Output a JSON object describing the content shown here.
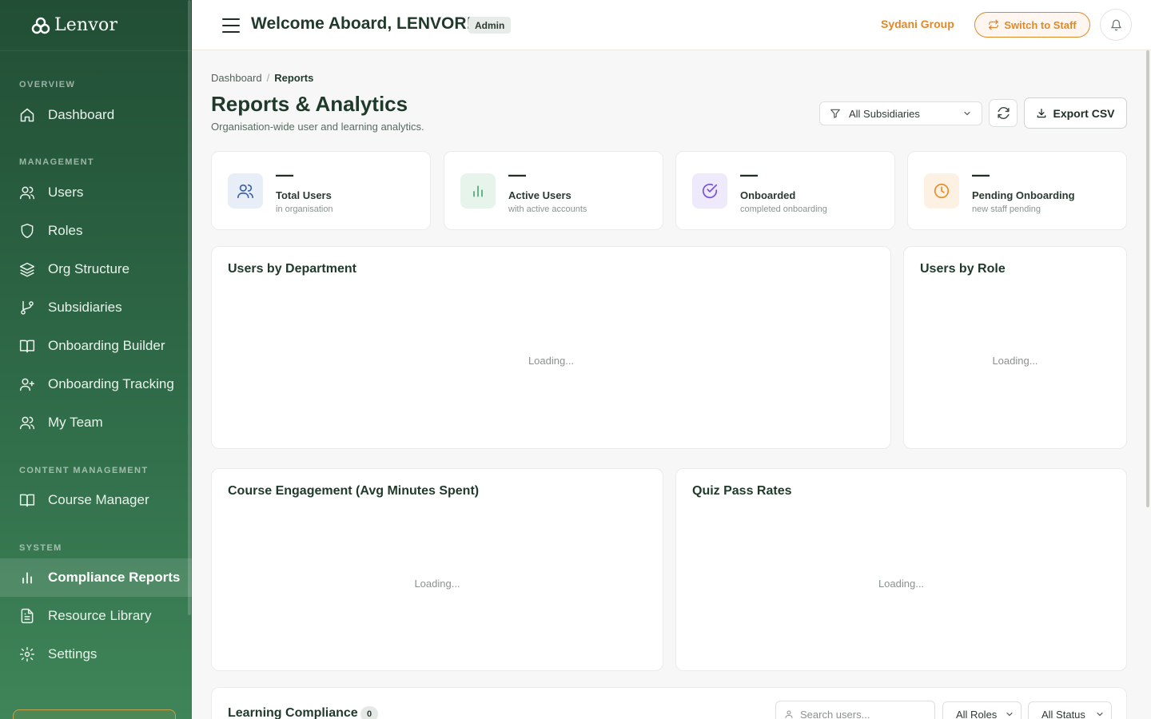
{
  "brand": {
    "name": "Lenvor"
  },
  "sidebar": {
    "sections": [
      {
        "title": "Overview",
        "items": [
          {
            "label": "Dashboard",
            "icon": "home-icon"
          }
        ]
      },
      {
        "title": "Management",
        "items": [
          {
            "label": "Users",
            "icon": "users-icon"
          },
          {
            "label": "Roles",
            "icon": "shield-icon"
          },
          {
            "label": "Org Structure",
            "icon": "layers-icon"
          },
          {
            "label": "Subsidiaries",
            "icon": "git-branch-icon"
          },
          {
            "label": "Onboarding Builder",
            "icon": "book-icon"
          },
          {
            "label": "Onboarding Tracking",
            "icon": "user-plus-icon"
          },
          {
            "label": "My Team",
            "icon": "users-icon"
          }
        ]
      },
      {
        "title": "Content Management",
        "items": [
          {
            "label": "Course Manager",
            "icon": "book-icon"
          }
        ]
      },
      {
        "title": "System",
        "items": [
          {
            "label": "Compliance Reports",
            "icon": "bar-chart-icon",
            "active": true
          },
          {
            "label": "Resource Library",
            "icon": "file-text-icon"
          },
          {
            "label": "Settings",
            "icon": "gear-icon"
          }
        ]
      }
    ]
  },
  "header": {
    "welcome": "Welcome Aboard, LENVOR!",
    "role_badge": "Admin",
    "org_name": "Sydani Group",
    "switch_label": "Switch to Staff"
  },
  "breadcrumb": {
    "root": "Dashboard",
    "separator": "/",
    "current": "Reports"
  },
  "page": {
    "title": "Reports & Analytics",
    "subtitle": "Organisation-wide user and learning analytics."
  },
  "toolbar": {
    "subsidiary_filter": "All Subsidiaries",
    "export_label": "Export CSV"
  },
  "stats": [
    {
      "value": "—",
      "label": "Total Users",
      "sub": "in organisation",
      "icon": "users-icon",
      "tint": "#e8eef8",
      "stroke": "#3a5fa8"
    },
    {
      "value": "—",
      "label": "Active Users",
      "sub": "with active accounts",
      "icon": "bar-chart-icon",
      "tint": "#e6f4ec",
      "stroke": "#3aa06a"
    },
    {
      "value": "—",
      "label": "Onboarded",
      "sub": "completed onboarding",
      "icon": "check-circle-icon",
      "tint": "#efeafb",
      "stroke": "#7b55d6"
    },
    {
      "value": "—",
      "label": "Pending Onboarding",
      "sub": "new staff pending",
      "icon": "clock-icon",
      "tint": "#fdf1e3",
      "stroke": "#e9902e"
    }
  ],
  "panels": {
    "users_by_department": {
      "title": "Users by Department",
      "loading": "Loading..."
    },
    "users_by_role": {
      "title": "Users by Role",
      "loading": "Loading..."
    },
    "course_engagement": {
      "title": "Course Engagement (Avg Minutes Spent)",
      "loading": "Loading..."
    },
    "quiz_pass_rates": {
      "title": "Quiz Pass Rates",
      "loading": "Loading..."
    }
  },
  "compliance": {
    "title": "Learning Compliance",
    "count": "0",
    "search_placeholder": "Search users...",
    "role_filter": "All Roles",
    "status_filter": "All Status"
  },
  "colors": {
    "sidebar": "#214e35",
    "accent": "#e0892a",
    "title": "#1f3a2a"
  }
}
